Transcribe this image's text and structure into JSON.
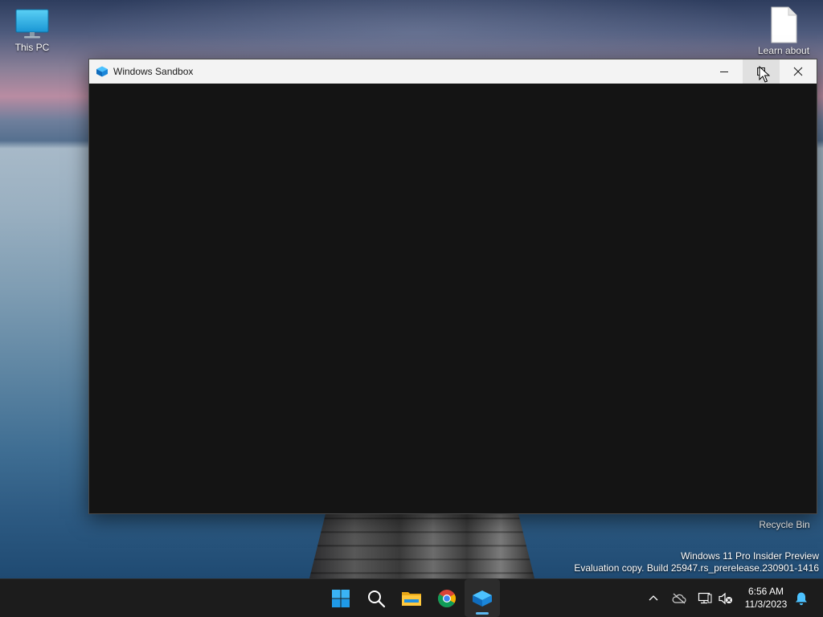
{
  "desktop": {
    "icons": {
      "this_pc": {
        "label": "This PC",
        "icon": "monitor-icon"
      },
      "learn_about": {
        "label": "Learn about",
        "icon": "document-icon"
      },
      "recycle_bin": {
        "label": "Recycle Bin",
        "icon": "recycle-bin-icon"
      }
    },
    "watermark": {
      "line1": "Windows 11 Pro Insider Preview",
      "line2": "Evaluation copy. Build 25947.rs_prerelease.230901-1416"
    }
  },
  "window": {
    "title": "Windows Sandbox",
    "icon": "sandbox-icon",
    "controls": [
      "minimize-icon",
      "maximize-icon",
      "close-icon"
    ],
    "content_color": "#141414"
  },
  "taskbar": {
    "apps": [
      {
        "name": "Start",
        "icon": "windows-logo-icon"
      },
      {
        "name": "Search",
        "icon": "search-icon"
      },
      {
        "name": "File Explorer",
        "icon": "folder-icon"
      },
      {
        "name": "Google Chrome",
        "icon": "chrome-icon"
      },
      {
        "name": "Windows Sandbox",
        "icon": "sandbox-icon",
        "active": true
      }
    ],
    "tray_icons": [
      "chevron-up-icon",
      "cloud-off-icon",
      "network-icon",
      "volume-muted-icon",
      "notification-bell-icon"
    ],
    "clock": {
      "time": "6:56 AM",
      "date": "11/3/2023"
    }
  },
  "colors": {
    "accent": "#0078d4",
    "taskbar_bg": "#1c1c1c",
    "titlebar_bg": "#f3f3f3"
  }
}
